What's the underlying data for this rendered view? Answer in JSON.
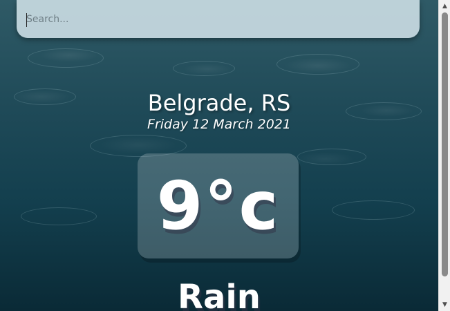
{
  "search": {
    "placeholder": "Search...",
    "value": ""
  },
  "location": {
    "name": "Belgrade, RS"
  },
  "date": {
    "text": "Friday 12 March 2021"
  },
  "temperature": {
    "display": "9°c"
  },
  "weather": {
    "condition": "Rain"
  },
  "scrollbar": {
    "up_icon": "▲",
    "down_icon": "▼"
  },
  "colors": {
    "background_top": "#2f5a66",
    "background_bottom": "#0a2a36",
    "search_bg": "#d0e1e8",
    "text": "#ffffff"
  }
}
